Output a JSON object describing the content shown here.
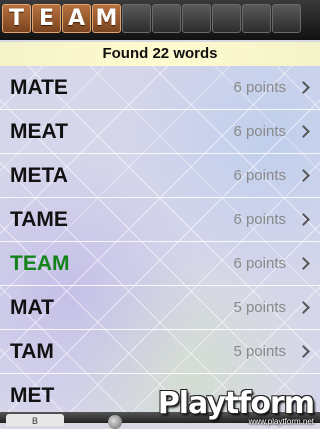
{
  "tiles": [
    {
      "letter": "T"
    },
    {
      "letter": "E"
    },
    {
      "letter": "A"
    },
    {
      "letter": "M"
    },
    {
      "letter": ""
    },
    {
      "letter": ""
    },
    {
      "letter": ""
    },
    {
      "letter": ""
    },
    {
      "letter": ""
    },
    {
      "letter": ""
    }
  ],
  "found_label": "Found 22 words",
  "words": [
    {
      "word": "MATE",
      "points": "6 points",
      "highlight": false
    },
    {
      "word": "MEAT",
      "points": "6 points",
      "highlight": false
    },
    {
      "word": "META",
      "points": "6 points",
      "highlight": false
    },
    {
      "word": "TAME",
      "points": "6 points",
      "highlight": false
    },
    {
      "word": "TEAM",
      "points": "6 points",
      "highlight": true
    },
    {
      "word": "MAT",
      "points": "5 points",
      "highlight": false
    },
    {
      "word": "TAM",
      "points": "5 points",
      "highlight": false
    },
    {
      "word": "MET",
      "points": "",
      "highlight": false
    }
  ],
  "bottom": {
    "button_label": "B"
  },
  "watermark": {
    "logo": "Playtform",
    "url": "www.playtform.net"
  },
  "colors": {
    "highlight": "#14841a",
    "tile": "#9a5a2e"
  }
}
